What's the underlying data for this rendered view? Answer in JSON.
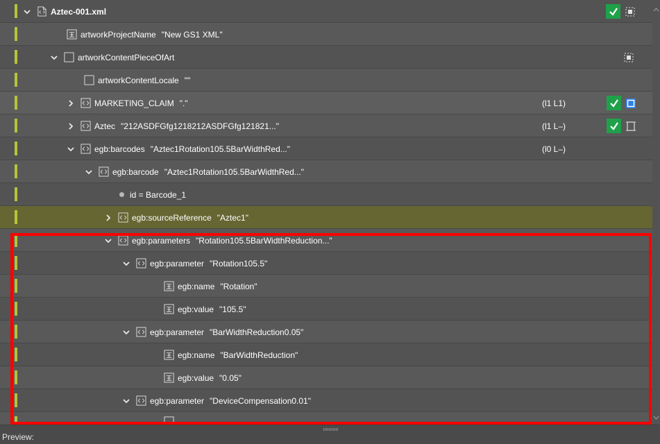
{
  "tree": {
    "rows": [
      {
        "label": "Aztec-001.xml",
        "value": "",
        "lines": "",
        "status": "valid"
      },
      {
        "label": "artworkProjectName",
        "value": "\"New GS1 XML\"",
        "lines": "",
        "status": ""
      },
      {
        "label": "artworkContentPieceOfArt",
        "value": "",
        "lines": "",
        "status": ""
      },
      {
        "label": "artworkContentLocale",
        "value": "\"\"",
        "lines": "",
        "status": ""
      },
      {
        "label": "MARKETING_CLAIM",
        "value": "\".\"",
        "lines": "(l1 L1)",
        "status": "valid"
      },
      {
        "label": "Aztec",
        "value": "\"212ASDFGfg1218212ASDFGfg121821...\"",
        "lines": "(l1 L–)",
        "status": "valid"
      },
      {
        "label": "egb:barcodes",
        "value": "\"Aztec1Rotation105.5BarWidthRed...\"",
        "lines": "(l0 L–)",
        "status": ""
      },
      {
        "label": "egb:barcode",
        "value": "\"Aztec1Rotation105.5BarWidthRed...\"",
        "lines": "",
        "status": ""
      },
      {
        "label": "id = Barcode_1",
        "value": "",
        "lines": "",
        "status": ""
      },
      {
        "label": "egb:sourceReference",
        "value": "\"Aztec1\"",
        "lines": "",
        "status": ""
      },
      {
        "label": "egb:parameters",
        "value": "\"Rotation105.5BarWidthReduction...\"",
        "lines": "",
        "status": ""
      },
      {
        "label": "egb:parameter",
        "value": "\"Rotation105.5\"",
        "lines": "",
        "status": ""
      },
      {
        "label": "egb:name",
        "value": "\"Rotation\"",
        "lines": "",
        "status": ""
      },
      {
        "label": "egb:value",
        "value": "\"105.5\"",
        "lines": "",
        "status": ""
      },
      {
        "label": "egb:parameter",
        "value": "\"BarWidthReduction0.05\"",
        "lines": "",
        "status": ""
      },
      {
        "label": "egb:name",
        "value": "\"BarWidthReduction\"",
        "lines": "",
        "status": ""
      },
      {
        "label": "egb:value",
        "value": "\"0.05\"",
        "lines": "",
        "status": ""
      },
      {
        "label": "egb:parameter",
        "value": "\"DeviceCompensation0.01\"",
        "lines": "",
        "status": ""
      }
    ]
  },
  "bottom": {
    "preview_label": "Preview:"
  },
  "colors": {
    "accent_bar": "#b6c43a",
    "check_green": "#1fa14a",
    "selected_row": "#666633",
    "highlight": "#ff0000",
    "frame_blue": "#2f7fe6"
  }
}
